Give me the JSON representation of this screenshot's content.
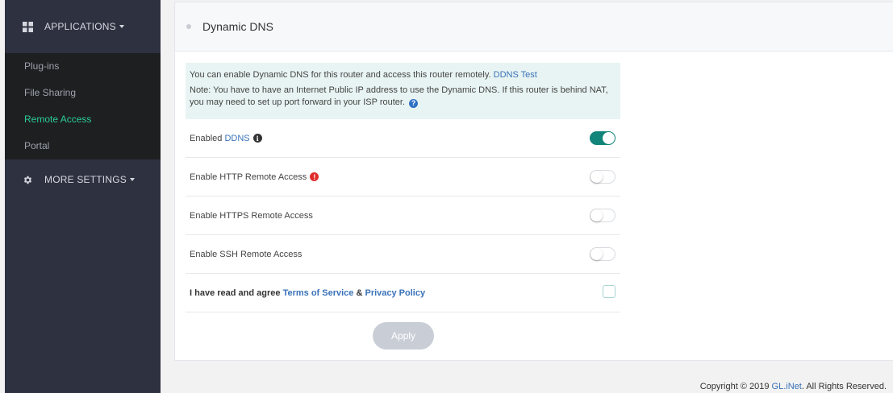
{
  "sidebar": {
    "applications": {
      "label": "APPLICATIONS",
      "icon": "grid-icon"
    },
    "items": [
      {
        "label": "Plug-ins",
        "active": false
      },
      {
        "label": "File Sharing",
        "active": false
      },
      {
        "label": "Remote Access",
        "active": true
      },
      {
        "label": "Portal",
        "active": false
      }
    ],
    "more_settings": {
      "label": "MORE SETTINGS",
      "icon": "gear-icon"
    }
  },
  "card": {
    "title": "Dynamic DNS",
    "notice": {
      "line1": "You can enable Dynamic DNS for this router and access this router remotely.",
      "line1_link": "DDNS Test",
      "line2": "Note: You have to have an Internet Public IP address to use the Dynamic DNS. If this router is behind NAT, you may need to set up port forward in your ISP router."
    },
    "rows": {
      "ddns": {
        "label": "Enabled",
        "link": "DDNS",
        "enabled": true
      },
      "http": {
        "label": "Enable HTTP Remote Access",
        "enabled": false
      },
      "https": {
        "label": "Enable HTTPS Remote Access",
        "enabled": false
      },
      "ssh": {
        "label": "Enable SSH Remote Access",
        "enabled": false
      }
    },
    "agree": {
      "prefix": "I have read and agree",
      "tos": "Terms of Service",
      "amp": "&",
      "privacy": "Privacy Policy",
      "checked": false
    },
    "apply_label": "Apply"
  },
  "footer": {
    "prefix": "Copyright © 2019",
    "brand": "GL.iNet",
    "suffix": ". All Rights Reserved."
  },
  "colors": {
    "sidebar_bg": "#2e3140",
    "submenu_bg": "#1d1f21",
    "active_item": "#2ecc9a",
    "toggle_on": "#11857a",
    "link": "#3a72b8",
    "warn": "#e02b2b"
  }
}
